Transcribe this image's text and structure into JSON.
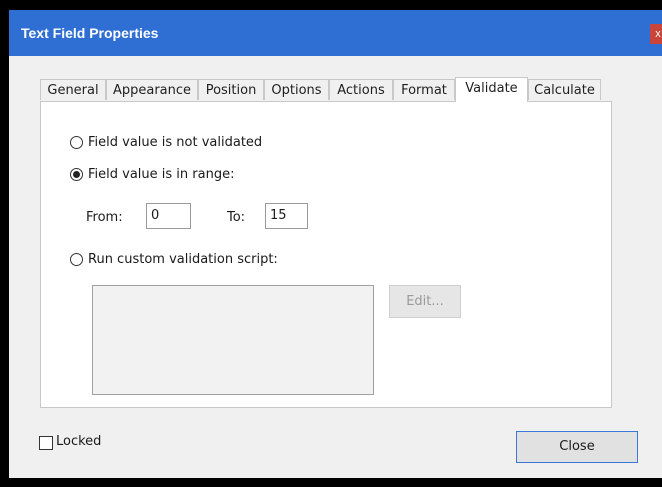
{
  "window": {
    "title": "Text Field Properties",
    "close_glyph": "x"
  },
  "tabs": [
    {
      "label": "General"
    },
    {
      "label": "Appearance"
    },
    {
      "label": "Position"
    },
    {
      "label": "Options"
    },
    {
      "label": "Actions"
    },
    {
      "label": "Format"
    },
    {
      "label": "Validate",
      "active": true
    },
    {
      "label": "Calculate"
    }
  ],
  "validate": {
    "option_not_validated": "Field value is not validated",
    "option_in_range": "Field value is in range:",
    "option_custom_script": "Run custom validation script:",
    "selected": "in_range",
    "from_label": "From:",
    "from_value": "0",
    "to_label": "To:",
    "to_value": "15",
    "edit_label": "Edit..."
  },
  "footer": {
    "locked_label": "Locked",
    "locked_checked": false,
    "close_label": "Close"
  },
  "colors": {
    "titlebar": "#2f6fd3",
    "close_button_border": "#3b78d8",
    "window_close_bg": "#c9453c"
  }
}
